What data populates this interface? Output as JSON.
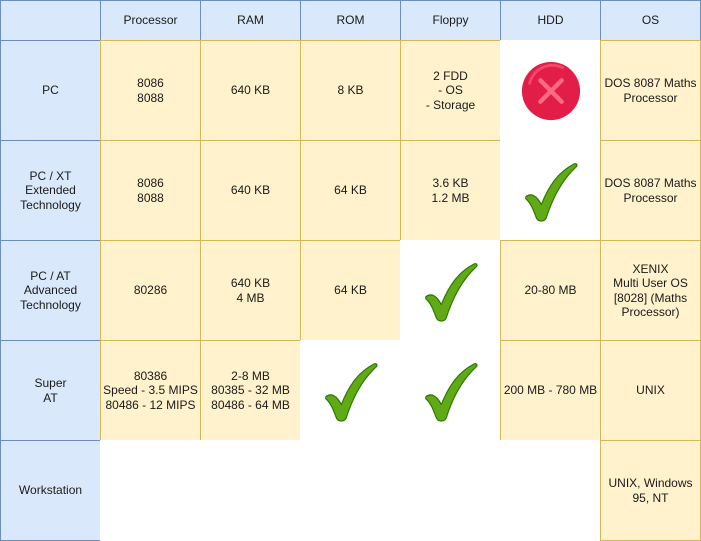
{
  "columns": [
    "",
    "Processor",
    "RAM",
    "ROM",
    "Floppy",
    "HDD",
    "OS"
  ],
  "rows": [
    {
      "label": "PC",
      "cells": [
        {
          "type": "text",
          "text": "8086\n8088"
        },
        {
          "type": "text",
          "text": "640 KB"
        },
        {
          "type": "text",
          "text": "8 KB"
        },
        {
          "type": "text",
          "text": "2 FDD\n- OS\n- Storage"
        },
        {
          "type": "icon",
          "icon": "cross-icon"
        },
        {
          "type": "text",
          "text": "DOS 8087 Maths Processor"
        }
      ]
    },
    {
      "label": "PC / XT\nExtended\nTechnology",
      "cells": [
        {
          "type": "text",
          "text": "8086\n8088"
        },
        {
          "type": "text",
          "text": "640 KB"
        },
        {
          "type": "text",
          "text": "64 KB"
        },
        {
          "type": "text",
          "text": "3.6 KB\n1.2 MB"
        },
        {
          "type": "icon",
          "icon": "checkmark-icon"
        },
        {
          "type": "text",
          "text": "DOS 8087 Maths Processor"
        }
      ]
    },
    {
      "label": "PC / AT\nAdvanced\nTechnology",
      "cells": [
        {
          "type": "text",
          "text": "80286"
        },
        {
          "type": "text",
          "text": "640 KB\n4 MB"
        },
        {
          "type": "text",
          "text": "64 KB"
        },
        {
          "type": "icon",
          "icon": "checkmark-icon"
        },
        {
          "type": "text",
          "text": "20-80 MB"
        },
        {
          "type": "text",
          "text": "XENIX\nMulti User OS\n[8028] (Maths\nProcessor)"
        }
      ]
    },
    {
      "label": "Super\nAT",
      "cells": [
        {
          "type": "text",
          "text": "80386\nSpeed - 3.5 MIPS\n80486 - 12 MIPS"
        },
        {
          "type": "text",
          "text": "2-8 MB\n80385 - 32 MB\n80486 - 64 MB"
        },
        {
          "type": "icon",
          "icon": "checkmark-icon"
        },
        {
          "type": "icon",
          "icon": "checkmark-icon"
        },
        {
          "type": "text",
          "text": "200 MB - 780 MB"
        },
        {
          "type": "text",
          "text": "UNIX"
        }
      ]
    },
    {
      "label": "Workstation",
      "cells": [
        {
          "type": "blank"
        },
        {
          "type": "blank"
        },
        {
          "type": "blank"
        },
        {
          "type": "blank"
        },
        {
          "type": "blank"
        },
        {
          "type": "text",
          "text": "UNIX, Windows\n95, NT"
        }
      ]
    }
  ],
  "colors": {
    "header_fill": "#dae8fc",
    "header_stroke": "#6c8ebf",
    "cell_fill": "#fff2cc",
    "cell_stroke": "#d6b656",
    "check_green": "#60a917",
    "check_stroke": "#2d7600",
    "cross_red": "#e11d48",
    "cross_light": "#ff6b81"
  }
}
